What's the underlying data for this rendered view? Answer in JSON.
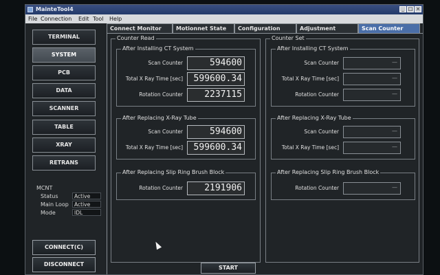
{
  "window": {
    "title": "MainteTool4",
    "min": "_",
    "max": "□",
    "close": "×"
  },
  "menu": [
    "File",
    "Connection",
    "Edit",
    "Tool",
    "Help"
  ],
  "nav": [
    "TERMINAL",
    "SYSTEM",
    "PCB",
    "DATA",
    "SCANNER",
    "TABLE",
    "XRAY",
    "RETRANS"
  ],
  "status": {
    "header": "MCNT",
    "rows": [
      {
        "label": "Status",
        "value": "Active"
      },
      {
        "label": "Main Loop",
        "value": "Active"
      },
      {
        "label": "Mode",
        "value": "IDL"
      }
    ]
  },
  "buttons": {
    "connect": "CONNECT(C)",
    "disconnect": "DISCONNECT",
    "start": "START"
  },
  "tabs": [
    "Connect Monitor",
    "Motionnet State",
    "Configuration",
    "Adjustment",
    "Scan Counter"
  ],
  "counter_read": {
    "title": "Counter Read",
    "ct": {
      "title": "After Installing CT System",
      "scan_label": "Scan Counter",
      "scan_value": "594600",
      "xray_label": "Total X Ray Time [sec]",
      "xray_value": "599600.34",
      "rot_label": "Rotation Counter",
      "rot_value": "2237115"
    },
    "tube": {
      "title": "After Replacing X-Ray Tube",
      "scan_label": "Scan Counter",
      "scan_value": "594600",
      "xray_label": "Total X Ray Time [sec]",
      "xray_value": "599600.34"
    },
    "slip": {
      "title": "After Replacing Slip Ring Brush Block",
      "rot_label": "Rotation Counter",
      "rot_value": "2191906"
    }
  },
  "counter_set": {
    "title": "Counter Set",
    "ct": {
      "title": "After Installing CT System",
      "scan_label": "Scan Counter",
      "xray_label": "Total X Ray Time [sec]",
      "rot_label": "Rotation Counter"
    },
    "tube": {
      "title": "After Replacing X-Ray Tube",
      "scan_label": "Scan Counter",
      "xray_label": "Total X Ray Time [sec]"
    },
    "slip": {
      "title": "After Replacing Slip Ring Brush Block",
      "rot_label": "Rotation Counter"
    },
    "field_value": "—"
  }
}
